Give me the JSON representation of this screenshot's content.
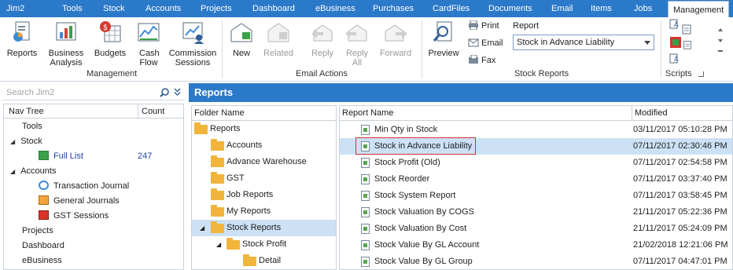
{
  "menu": {
    "tabs": [
      "Jim2",
      "Tools",
      "Stock",
      "Accounts",
      "Projects",
      "Dashboard",
      "eBusiness",
      "Purchases",
      "CardFiles",
      "Documents",
      "Email",
      "Items",
      "Jobs",
      "Management"
    ],
    "active": "Management"
  },
  "ribbon": {
    "management": {
      "reports": "Reports",
      "business_analysis": "Business Analysis",
      "budgets": "Budgets",
      "cash_flow": "Cash Flow",
      "commission_sessions": "Commission Sessions",
      "group_label": "Management"
    },
    "email_actions": {
      "new": "New",
      "related": "Related",
      "reply": "Reply",
      "reply_all": "Reply All",
      "forward": "Forward",
      "group_label": "Email Actions"
    },
    "stock_reports": {
      "preview": "Preview",
      "print": "Print",
      "email": "Email",
      "fax": "Fax",
      "report_label": "Report",
      "report_value": "Stock in Advance Liability",
      "group_label": "Stock Reports"
    },
    "scripts": {
      "group_label": "Scripts"
    }
  },
  "search": {
    "placeholder": "Search Jim2"
  },
  "navtree": {
    "col_name": "Nav Tree",
    "col_count": "Count",
    "items": [
      {
        "label": "Tools"
      },
      {
        "label": "Stock"
      },
      {
        "label": "Full List",
        "count": "247"
      },
      {
        "label": "Accounts"
      },
      {
        "label": "Transaction Journal"
      },
      {
        "label": "General Journals"
      },
      {
        "label": "GST Sessions"
      },
      {
        "label": "Projects"
      },
      {
        "label": "Dashboard"
      },
      {
        "label": "eBusiness"
      }
    ]
  },
  "panel_title": "Reports",
  "folders": {
    "col": "Folder Name",
    "items": [
      "Reports",
      "Accounts",
      "Advance Warehouse",
      "GST",
      "Job Reports",
      "My Reports",
      "Stock Reports",
      "Stock Profit",
      "Detail"
    ]
  },
  "reports": {
    "col_name": "Report Name",
    "col_modified": "Modified",
    "rows": [
      {
        "name": "Min Qty in Stock",
        "modified": "03/11/2017 05:10:28 PM"
      },
      {
        "name": "Stock in Advance Liability",
        "modified": "07/11/2017 02:30:46 PM"
      },
      {
        "name": "Stock Profit (Old)",
        "modified": "07/11/2017 02:54:58 PM"
      },
      {
        "name": "Stock Reorder",
        "modified": "07/11/2017 03:37:40 PM"
      },
      {
        "name": "Stock System Report",
        "modified": "07/11/2017 03:58:45 PM"
      },
      {
        "name": "Stock Valuation By COGS",
        "modified": "21/11/2017 05:22:36 PM"
      },
      {
        "name": "Stock Valuation By Cost",
        "modified": "21/11/2017 05:24:09 PM"
      },
      {
        "name": "Stock Value By GL Account",
        "modified": "21/02/2018 12:21:06 PM"
      },
      {
        "name": "Stock Value By GL Group",
        "modified": "07/11/2017 04:47:01 PM"
      }
    ]
  },
  "colors": {
    "accent": "#2b79c9",
    "selection": "#cce1f5",
    "highlight_border": "#d23232"
  }
}
